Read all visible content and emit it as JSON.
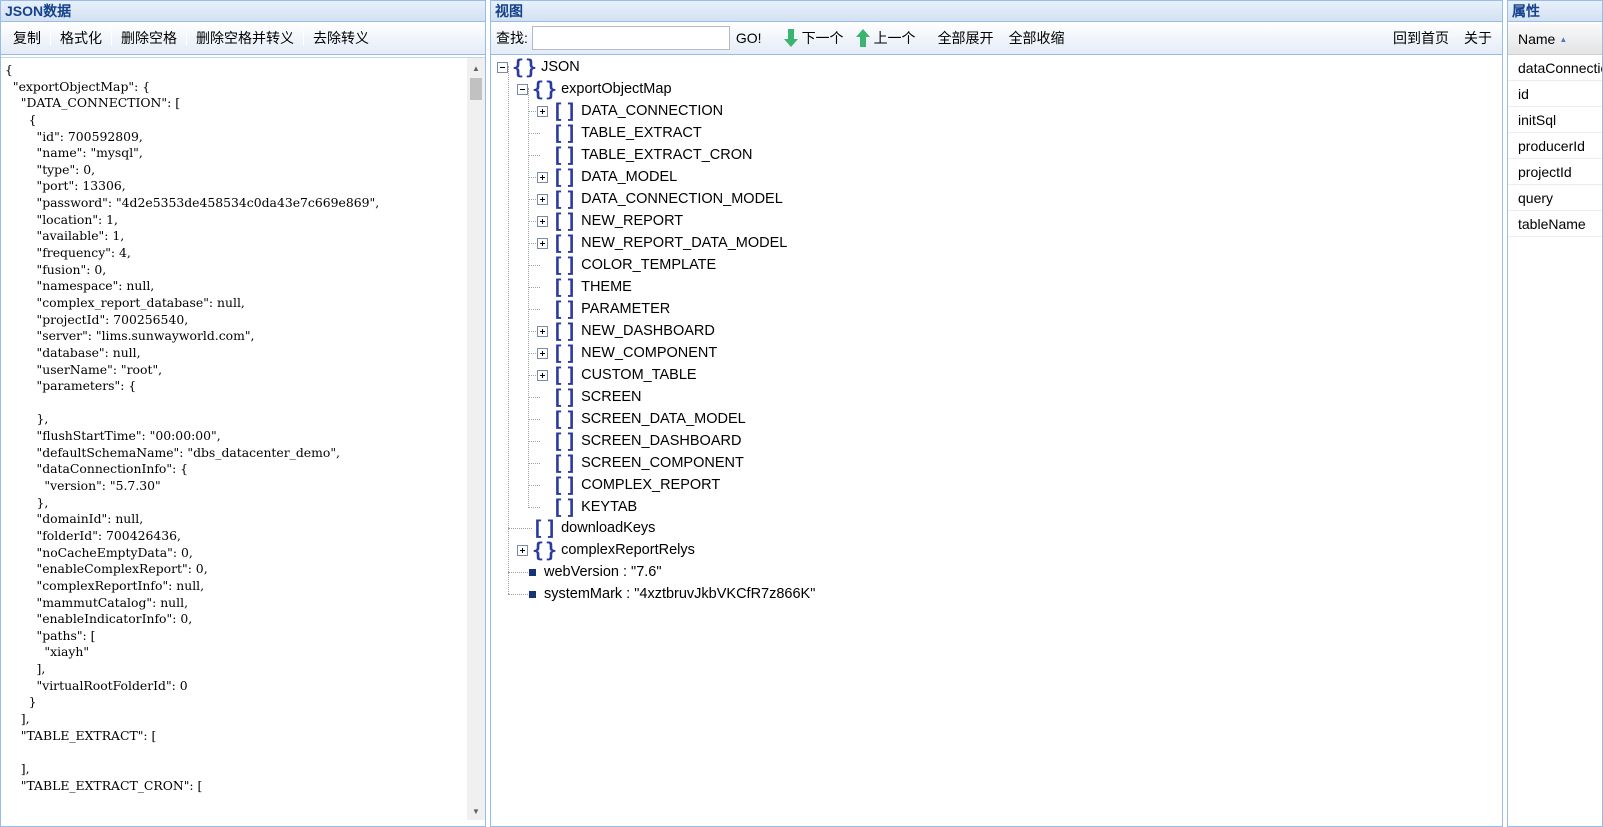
{
  "left": {
    "title": "JSON数据",
    "toolbar": [
      "复制",
      "格式化",
      "删除空格",
      "删除空格并转义",
      "去除转义"
    ],
    "editor_lines": [
      "{",
      "  \"exportObjectMap\": {",
      "    \"DATA_CONNECTION\": [",
      "      {",
      "        \"id\": 700592809,",
      "        \"name\": \"mysql\",",
      "        \"type\": 0,",
      "        \"port\": 13306,",
      "        \"password\": \"4d2e5353de458534c0da43e7c669e869\",",
      "        \"location\": 1,",
      "        \"available\": 1,",
      "        \"frequency\": 4,",
      "        \"fusion\": 0,",
      "        \"namespace\": null,",
      "        \"complex_report_database\": null,",
      "        \"projectId\": 700256540,",
      "        \"server\": \"lims.sunwayworld.com\",",
      "        \"database\": null,",
      "        \"userName\": \"root\",",
      "        \"parameters\": {",
      "",
      "        },",
      "        \"flushStartTime\": \"00:00:00\",",
      "        \"defaultSchemaName\": \"dbs_datacenter_demo\",",
      "        \"dataConnectionInfo\": {",
      "          \"version\": \"5.7.30\"",
      "        },",
      "        \"domainId\": null,",
      "        \"folderId\": 700426436,",
      "        \"noCacheEmptyData\": 0,",
      "        \"enableComplexReport\": 0,",
      "        \"complexReportInfo\": null,",
      "        \"mammutCatalog\": null,",
      "        \"enableIndicatorInfo\": 0,",
      "        \"paths\": [",
      "          \"xiayh\"",
      "        ],",
      "        \"virtualRootFolderId\": 0",
      "      }",
      "    ],",
      "    \"TABLE_EXTRACT\": [",
      "",
      "    ],",
      "    \"TABLE_EXTRACT_CRON\": ["
    ]
  },
  "mid": {
    "title": "视图",
    "find_label": "查找:",
    "find_value": "",
    "go_label": "GO!",
    "next_label": "下一个",
    "prev_label": "上一个",
    "expand_all": "全部展开",
    "collapse_all": "全部收缩",
    "home_label": "回到首页",
    "about_label": "关于",
    "tree": {
      "root": "JSON",
      "export_map": "exportObjectMap",
      "children": [
        {
          "label": "DATA_CONNECTION",
          "expandable": true
        },
        {
          "label": "TABLE_EXTRACT",
          "expandable": false
        },
        {
          "label": "TABLE_EXTRACT_CRON",
          "expandable": false
        },
        {
          "label": "DATA_MODEL",
          "expandable": true
        },
        {
          "label": "DATA_CONNECTION_MODEL",
          "expandable": true
        },
        {
          "label": "NEW_REPORT",
          "expandable": true
        },
        {
          "label": "NEW_REPORT_DATA_MODEL",
          "expandable": true
        },
        {
          "label": "COLOR_TEMPLATE",
          "expandable": false
        },
        {
          "label": "THEME",
          "expandable": false
        },
        {
          "label": "PARAMETER",
          "expandable": false
        },
        {
          "label": "NEW_DASHBOARD",
          "expandable": true
        },
        {
          "label": "NEW_COMPONENT",
          "expandable": true
        },
        {
          "label": "CUSTOM_TABLE",
          "expandable": true
        },
        {
          "label": "SCREEN",
          "expandable": false
        },
        {
          "label": "SCREEN_DATA_MODEL",
          "expandable": false
        },
        {
          "label": "SCREEN_DASHBOARD",
          "expandable": false
        },
        {
          "label": "SCREEN_COMPONENT",
          "expandable": false
        },
        {
          "label": "COMPLEX_REPORT",
          "expandable": false
        },
        {
          "label": "KEYTAB",
          "expandable": false
        }
      ],
      "download_keys": "downloadKeys",
      "complex_relys": "complexReportRelys",
      "web_version": "webVersion : \"7.6\"",
      "system_mark": "systemMark : \"4xztbruvJkbVKCfR7z866K\""
    }
  },
  "right": {
    "title": "属性",
    "column": "Name",
    "rows": [
      "dataConnectionId",
      "id",
      "initSql",
      "producerId",
      "projectId",
      "query",
      "tableName"
    ]
  },
  "colors": {
    "header_text": "#15428b",
    "border": "#99bbe8",
    "icon": "#2a3aa0",
    "arrow_green": "#3cb371"
  }
}
